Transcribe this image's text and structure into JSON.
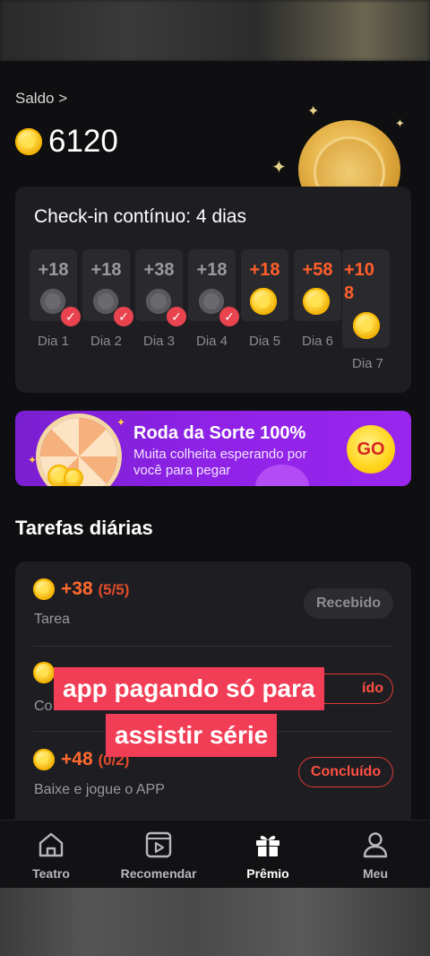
{
  "balance": {
    "label": "Saldo >",
    "value": "6120"
  },
  "checkin": {
    "title": "Check-in contínuo: 4 dias",
    "days": [
      {
        "amount": "+18",
        "label": "Dia 1",
        "claimed": true
      },
      {
        "amount": "+18",
        "label": "Dia 2",
        "claimed": true
      },
      {
        "amount": "+38",
        "label": "Dia 3",
        "claimed": true
      },
      {
        "amount": "+18",
        "label": "Dia 4",
        "claimed": true
      },
      {
        "amount": "+18",
        "label": "Dia 5",
        "claimed": false
      },
      {
        "amount": "+58",
        "label": "Dia 6",
        "claimed": false
      },
      {
        "amount_line1": "+10",
        "amount_line2": "8",
        "label": "Dia 7",
        "claimed": false
      }
    ]
  },
  "banner": {
    "title": "Roda da Sorte 100%",
    "subtitle_line1": "Muita colheita esperando por",
    "subtitle_line2": "você para pegar",
    "button": "GO"
  },
  "tasks": {
    "title": "Tarefas diárias",
    "items": [
      {
        "amount": "+38",
        "count": "(5/5)",
        "desc": "Tarea",
        "button": "Recebido"
      },
      {
        "amount": "",
        "count": "",
        "desc": "Co",
        "button": "ído"
      },
      {
        "amount": "+48",
        "count": "(0/2)",
        "desc": "Baixe e jogue o APP",
        "button": "Concluído"
      }
    ]
  },
  "caption": {
    "line1": "app pagando só para",
    "line2": "assistir série"
  },
  "nav": {
    "items": [
      {
        "label": "Teatro",
        "icon": "home-icon"
      },
      {
        "label": "Recomendar",
        "icon": "video-play-icon"
      },
      {
        "label": "Prêmio",
        "icon": "gift-icon",
        "active": true
      },
      {
        "label": "Meu",
        "icon": "user-icon"
      }
    ]
  },
  "colors": {
    "accent_orange": "#ff5e2a",
    "caption_red": "#f23d56",
    "banner_purple": "#8f22e6",
    "check_red": "#e8434f"
  }
}
